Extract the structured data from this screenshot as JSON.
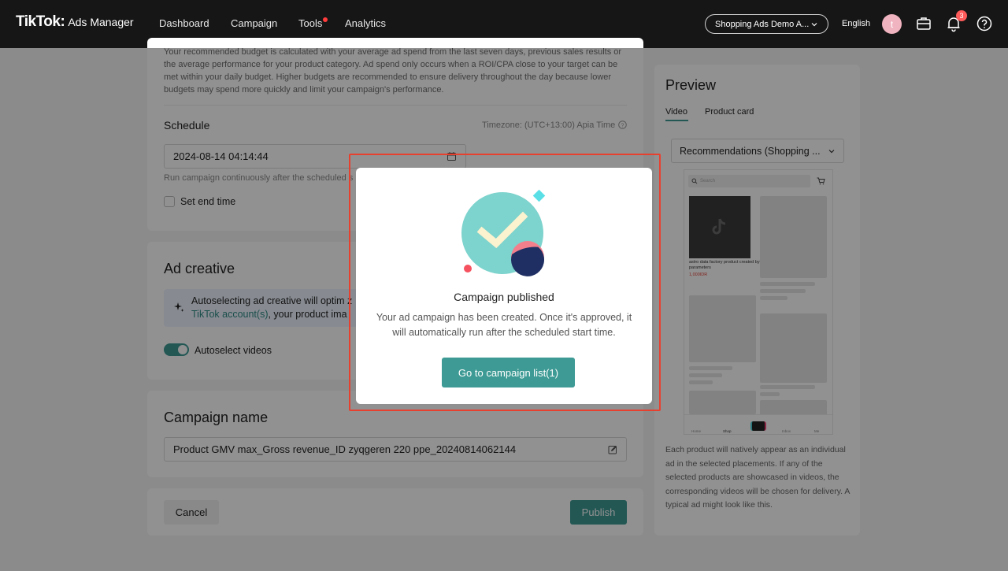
{
  "header": {
    "logo_main": "TikTok",
    "logo_separator": ":",
    "logo_sub": "Ads Manager",
    "nav": [
      "Dashboard",
      "Campaign",
      "Tools",
      "Analytics"
    ],
    "account": "Shopping Ads Demo A...",
    "language": "English",
    "avatar_initial": "t",
    "notification_count": "3"
  },
  "budget": {
    "description": "Your recommended budget is calculated with your average ad spend from the last seven days, previous sales results or the average performance for your product category. Ad spend only occurs when a ROI/CPA close to your target can be met within your daily budget. Higher budgets are recommended to ensure delivery throughout the day because lower budgets may spend more quickly and limit your campaign's performance."
  },
  "schedule": {
    "title": "Schedule",
    "timezone": "Timezone: (UTC+13:00) Apia Time",
    "start_value": "2024-08-14 04:14:44",
    "hint": "Run campaign continuously after the scheduled s",
    "end_time_label": "Set end time"
  },
  "ad_creative": {
    "title": "Ad creative",
    "info_line1": "Autoselecting ad creative will optim z",
    "info_link": "TikTok account(s)",
    "info_line2_rest": ", your product ima",
    "autoselect_label": "Autoselect videos",
    "autoselect_on": true
  },
  "campaign_name": {
    "title": "Campaign name",
    "value": "Product GMV max_Gross revenue_ID zyqgeren 220 ppe_20240814062144"
  },
  "footer": {
    "cancel": "Cancel",
    "publish": "Publish"
  },
  "preview": {
    "title": "Preview",
    "tabs": [
      "Video",
      "Product card"
    ],
    "active_tab": "Video",
    "placement": "Recommendations (Shopping ...",
    "search_placeholder": "Search",
    "product_name": "astro data factory product created by parameters",
    "product_price": "1,000IDR",
    "bottom_nav": [
      "Home",
      "Shop",
      "Inbox",
      "Me"
    ],
    "description": "Each product will natively appear as an individual ad in the selected placements. If any of the selected products are showcased in videos, the corresponding videos will be chosen for delivery. A typical ad might look like this."
  },
  "modal": {
    "title": "Campaign published",
    "text": "Your ad campaign has been created. Once it's approved, it will automatically run after the scheduled start time.",
    "button": "Go to campaign list(1)"
  },
  "colors": {
    "accent": "#3d9a94",
    "topbar": "#161616",
    "highlight": "#e8402f",
    "badge": "#fe5b5b"
  }
}
